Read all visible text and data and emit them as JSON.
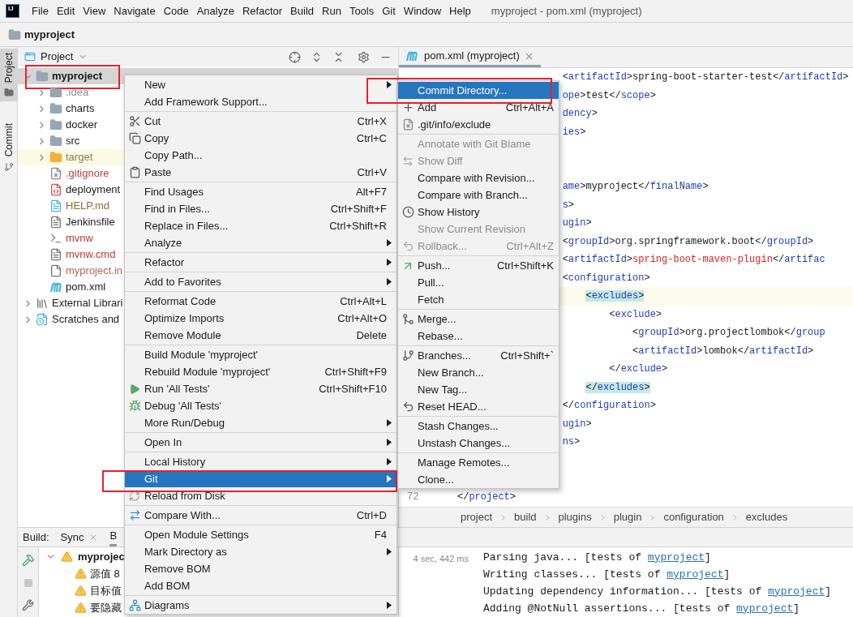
{
  "logo": "IJ",
  "menubar": [
    "File",
    "Edit",
    "View",
    "Navigate",
    "Code",
    "Analyze",
    "Refactor",
    "Build",
    "Run",
    "Tools",
    "Git",
    "Window",
    "Help"
  ],
  "window": {
    "title": "myproject - pom.xml (myproject)"
  },
  "navbar": {
    "label": "myproject"
  },
  "tool_stripe": [
    {
      "label": "Project",
      "selected": true
    },
    {
      "label": "Commit",
      "selected": false
    }
  ],
  "project_panel": {
    "title": "Project",
    "tree": [
      {
        "label": "myproject",
        "kind": "module",
        "expanded": true,
        "selected": true,
        "framed": true,
        "children": [
          {
            "label": ".idea",
            "kind": "folder",
            "expanded": false,
            "selected": false,
            "framed": false,
            "color": "#8c8c8c"
          },
          {
            "label": "charts",
            "kind": "folder",
            "expanded": false,
            "selected": false,
            "framed": false
          },
          {
            "label": "docker",
            "kind": "folder",
            "expanded": false,
            "selected": false,
            "framed": false
          },
          {
            "label": "src",
            "kind": "folder",
            "expanded": false,
            "selected": false,
            "framed": false
          },
          {
            "label": "target",
            "kind": "excluded",
            "expanded": false,
            "selected": false,
            "framed": false,
            "color": "#8c7a55"
          },
          {
            "label": ".gitignore",
            "kind": "ignored",
            "selected": false,
            "framed": false,
            "color": "#b5442c"
          },
          {
            "label": "deployment",
            "kind": "yaml",
            "selected": false,
            "framed": false
          },
          {
            "label": "HELP.md",
            "kind": "markdown",
            "selected": false,
            "framed": false,
            "color": "#8f6b32"
          },
          {
            "label": "Jenkinsfile",
            "kind": "text",
            "selected": false,
            "framed": false
          },
          {
            "label": "mvnw",
            "kind": "script",
            "selected": false,
            "framed": false,
            "color": "#c0392b"
          },
          {
            "label": "mvnw.cmd",
            "kind": "text",
            "selected": false,
            "framed": false,
            "color": "#c0392b"
          },
          {
            "label": "myproject.in",
            "kind": "config",
            "selected": false,
            "framed": false,
            "color": "#b86355"
          },
          {
            "label": "pom.xml",
            "kind": "maven",
            "selected": false,
            "framed": false
          }
        ]
      },
      {
        "label": "External Librari",
        "kind": "library",
        "expanded": false,
        "selected": false,
        "framed": false
      },
      {
        "label": "Scratches and",
        "kind": "scratches",
        "expanded": false,
        "selected": false,
        "framed": false
      }
    ]
  },
  "editor": {
    "tabs": [
      {
        "label": "pom.xml (myproject)",
        "selected": true
      }
    ],
    "lines": [
      {
        "current": false,
        "segments": [
          {
            "text": "                  <artifactId>",
            "kind": "tag"
          },
          {
            "text": "spring-boot-starter-test",
            "kind": "plain"
          },
          {
            "text": "</artifactId>",
            "kind": "tag"
          }
        ]
      },
      {
        "current": false,
        "segments": [
          {
            "text": "                  ope>",
            "kind": "tag"
          },
          {
            "text": "test",
            "kind": "plain"
          },
          {
            "text": "</scope>",
            "kind": "tag"
          }
        ]
      },
      {
        "current": false,
        "segments": [
          {
            "text": "                  dency>",
            "kind": "tag"
          }
        ]
      },
      {
        "current": false,
        "segments": [
          {
            "text": "                  ies>",
            "kind": "tag"
          }
        ]
      },
      {
        "current": false
      },
      {
        "current": false
      },
      {
        "current": false,
        "segments": [
          {
            "text": "                  ame>",
            "kind": "tag"
          },
          {
            "text": "myproject",
            "kind": "plain"
          },
          {
            "text": "</finalName>",
            "kind": "tag"
          }
        ]
      },
      {
        "current": false,
        "segments": [
          {
            "text": "                  s>",
            "kind": "tag"
          }
        ]
      },
      {
        "current": false,
        "segments": [
          {
            "text": "                  ugin>",
            "kind": "tag"
          }
        ]
      },
      {
        "current": false,
        "segments": [
          {
            "text": "                  <groupId>",
            "kind": "tag"
          },
          {
            "text": "org.springframework.boot",
            "kind": "plain"
          },
          {
            "text": "</groupId>",
            "kind": "tag"
          }
        ]
      },
      {
        "current": false,
        "segments": [
          {
            "text": "                  <artifactId>",
            "kind": "tag"
          },
          {
            "text": "spring-boot-maven-plugin",
            "kind": "error"
          },
          {
            "text": "</artifac",
            "kind": "tag"
          }
        ]
      },
      {
        "current": false,
        "segments": [
          {
            "text": "                  <configuration>",
            "kind": "tag"
          }
        ]
      },
      {
        "current": true,
        "segments": [
          {
            "text": "                      <excludes>",
            "kind": "matched"
          }
        ]
      },
      {
        "current": false,
        "segments": [
          {
            "text": "                          <exclude>",
            "kind": "tag"
          }
        ]
      },
      {
        "current": false,
        "segments": [
          {
            "text": "                              <groupId>",
            "kind": "tag"
          },
          {
            "text": "org.projectlombok",
            "kind": "plain"
          },
          {
            "text": "</group",
            "kind": "tag"
          }
        ]
      },
      {
        "current": false,
        "segments": [
          {
            "text": "                              <artifactId>",
            "kind": "tag"
          },
          {
            "text": "lombok",
            "kind": "plain"
          },
          {
            "text": "</artifactId>",
            "kind": "tag"
          }
        ]
      },
      {
        "current": false,
        "segments": [
          {
            "text": "                          </exclude>",
            "kind": "tag"
          }
        ]
      },
      {
        "current": false,
        "segments": [
          {
            "text": "                      </excludes>",
            "kind": "matched"
          }
        ]
      },
      {
        "current": false,
        "segments": [
          {
            "text": "                  </configuration>",
            "kind": "tag"
          }
        ]
      },
      {
        "current": false,
        "segments": [
          {
            "text": "                  ugin>",
            "kind": "tag"
          }
        ]
      },
      {
        "current": false,
        "segments": [
          {
            "text": "                  ns>",
            "kind": "tag"
          }
        ]
      },
      {
        "current": false
      },
      {
        "current": false
      },
      {
        "current": false,
        "number": "72",
        "segments": [
          {
            "text": "</project>",
            "kind": "tag"
          }
        ]
      }
    ],
    "breadcrumbs": [
      "project",
      "build",
      "plugins",
      "plugin",
      "configuration",
      "excludes"
    ]
  },
  "build_panel": {
    "title": "Build:",
    "tabs": [
      {
        "label": "Sync",
        "selected": false
      },
      {
        "label": "B",
        "selected": true
      }
    ],
    "tree": {
      "label": "myprojec",
      "children": [
        "源值 8",
        "目标值",
        "要隐藏"
      ]
    },
    "duration": "4 sec, 442 ms",
    "console": [
      {
        "text": "Parsing java... [tests of ",
        "link": "myproject",
        "after": "]"
      },
      {
        "text": "Writing classes... [tests of ",
        "link": "myproject",
        "after": "]"
      },
      {
        "text": "Updating dependency information... [tests of ",
        "link": "myproject",
        "after": "]"
      },
      {
        "text": "Adding @NotNull assertions... [tests of ",
        "link": "myproject",
        "after": "]"
      }
    ]
  },
  "context_menu": [
    [
      {
        "label": "New",
        "submenu": true,
        "selected": false,
        "framed": false
      },
      {
        "label": "Add Framework Support...",
        "submenu": false,
        "selected": false,
        "framed": false
      }
    ],
    [
      {
        "label": "Cut",
        "shortcut": "Ctrl+X",
        "submenu": false,
        "selected": false,
        "framed": false
      },
      {
        "label": "Copy",
        "shortcut": "Ctrl+C",
        "submenu": false,
        "selected": false,
        "framed": false
      },
      {
        "label": "Copy Path...",
        "submenu": false,
        "selected": false,
        "framed": false
      },
      {
        "label": "Paste",
        "shortcut": "Ctrl+V",
        "submenu": false,
        "selected": false,
        "framed": false
      }
    ],
    [
      {
        "label": "Find Usages",
        "shortcut": "Alt+F7",
        "submenu": false,
        "selected": false,
        "framed": false
      },
      {
        "label": "Find in Files...",
        "shortcut": "Ctrl+Shift+F",
        "submenu": false,
        "selected": false,
        "framed": false
      },
      {
        "label": "Replace in Files...",
        "shortcut": "Ctrl+Shift+R",
        "submenu": false,
        "selected": false,
        "framed": false
      },
      {
        "label": "Analyze",
        "submenu": true,
        "selected": false,
        "framed": false
      }
    ],
    [
      {
        "label": "Refactor",
        "submenu": true,
        "selected": false,
        "framed": false
      }
    ],
    [
      {
        "label": "Add to Favorites",
        "submenu": true,
        "selected": false,
        "framed": false
      }
    ],
    [
      {
        "label": "Reformat Code",
        "shortcut": "Ctrl+Alt+L",
        "submenu": false,
        "selected": false,
        "framed": false
      },
      {
        "label": "Optimize Imports",
        "shortcut": "Ctrl+Alt+O",
        "submenu": false,
        "selected": false,
        "framed": false
      },
      {
        "label": "Remove Module",
        "shortcut": "Delete",
        "submenu": false,
        "selected": false,
        "framed": false
      }
    ],
    [
      {
        "label": "Build Module 'myproject'",
        "submenu": false,
        "selected": false,
        "framed": false
      },
      {
        "label": "Rebuild Module 'myproject'",
        "shortcut": "Ctrl+Shift+F9",
        "submenu": false,
        "selected": false,
        "framed": false
      },
      {
        "label": "Run 'All Tests'",
        "shortcut": "Ctrl+Shift+F10",
        "submenu": false,
        "selected": false,
        "framed": false
      },
      {
        "label": "Debug 'All Tests'",
        "submenu": false,
        "selected": false,
        "framed": false
      },
      {
        "label": "More Run/Debug",
        "submenu": true,
        "selected": false,
        "framed": false
      }
    ],
    [
      {
        "label": "Open In",
        "submenu": true,
        "selected": false,
        "framed": false
      }
    ],
    [
      {
        "label": "Local History",
        "submenu": true,
        "selected": false,
        "framed": false
      },
      {
        "label": "Git",
        "submenu": true,
        "selected": true,
        "framed": true
      },
      {
        "label": "Reload from Disk",
        "submenu": false,
        "selected": false,
        "framed": false
      }
    ],
    [
      {
        "label": "Compare With...",
        "shortcut": "Ctrl+D",
        "submenu": false,
        "selected": false,
        "framed": false
      }
    ],
    [
      {
        "label": "Open Module Settings",
        "shortcut": "F4",
        "submenu": false,
        "selected": false,
        "framed": false
      },
      {
        "label": "Mark Directory as",
        "submenu": true,
        "selected": false,
        "framed": false
      },
      {
        "label": "Remove BOM",
        "submenu": false,
        "selected": false,
        "framed": false
      },
      {
        "label": "Add BOM",
        "submenu": false,
        "selected": false,
        "framed": false
      }
    ],
    [
      {
        "label": "Diagrams",
        "submenu": true,
        "selected": false,
        "framed": false
      }
    ]
  ],
  "git_submenu": [
    [
      {
        "label": "Commit Directory...",
        "selected": true,
        "disabled": false,
        "framed": true
      },
      {
        "label": "Add",
        "shortcut": "Ctrl+Alt+A",
        "selected": false,
        "disabled": false,
        "framed": false
      },
      {
        "label": ".git/info/exclude",
        "selected": false,
        "disabled": false,
        "framed": false
      }
    ],
    [
      {
        "label": "Annotate with Git Blame",
        "selected": false,
        "disabled": true,
        "framed": false
      },
      {
        "label": "Show Diff",
        "selected": false,
        "disabled": true,
        "framed": false
      },
      {
        "label": "Compare with Revision...",
        "selected": false,
        "disabled": false,
        "framed": false
      },
      {
        "label": "Compare with Branch...",
        "selected": false,
        "disabled": false,
        "framed": false
      },
      {
        "label": "Show History",
        "selected": false,
        "disabled": false,
        "framed": false
      },
      {
        "label": "Show Current Revision",
        "selected": false,
        "disabled": true,
        "framed": false
      },
      {
        "label": "Rollback...",
        "shortcut": "Ctrl+Alt+Z",
        "selected": false,
        "disabled": true,
        "framed": false
      }
    ],
    [
      {
        "label": "Push...",
        "shortcut": "Ctrl+Shift+K",
        "selected": false,
        "disabled": false,
        "framed": false
      },
      {
        "label": "Pull...",
        "selected": false,
        "disabled": false,
        "framed": false
      },
      {
        "label": "Fetch",
        "selected": false,
        "disabled": false,
        "framed": false
      }
    ],
    [
      {
        "label": "Merge...",
        "selected": false,
        "disabled": false,
        "framed": false
      },
      {
        "label": "Rebase...",
        "selected": false,
        "disabled": false,
        "framed": false
      }
    ],
    [
      {
        "label": "Branches...",
        "shortcut": "Ctrl+Shift+`",
        "selected": false,
        "disabled": false,
        "framed": false
      },
      {
        "label": "New Branch...",
        "selected": false,
        "disabled": false,
        "framed": false
      },
      {
        "label": "New Tag...",
        "selected": false,
        "disabled": false,
        "framed": false
      },
      {
        "label": "Reset HEAD...",
        "selected": false,
        "disabled": false,
        "framed": false
      }
    ],
    [
      {
        "label": "Stash Changes...",
        "selected": false,
        "disabled": false,
        "framed": false
      },
      {
        "label": "Unstash Changes...",
        "selected": false,
        "disabled": false,
        "framed": false
      }
    ],
    [
      {
        "label": "Manage Remotes...",
        "selected": false,
        "disabled": false,
        "framed": false
      },
      {
        "label": "Clone...",
        "selected": false,
        "disabled": false,
        "framed": false
      }
    ]
  ]
}
